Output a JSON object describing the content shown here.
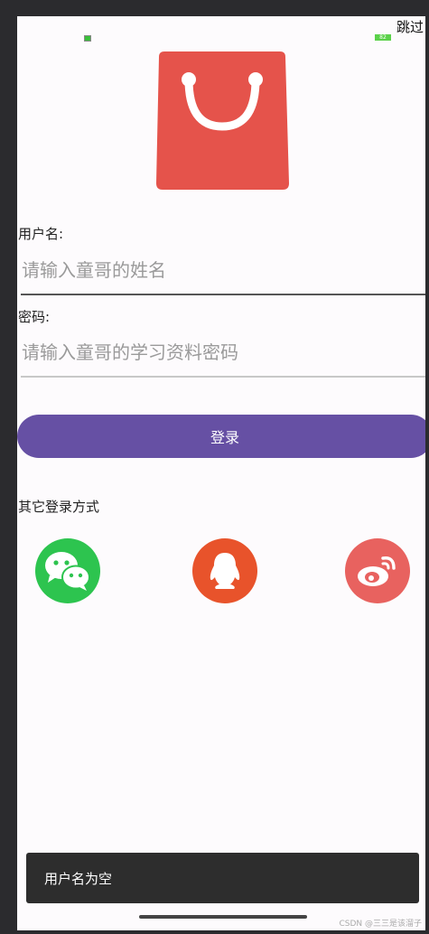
{
  "header": {
    "skip_label": "跳过"
  },
  "status": {
    "battery_text": "82"
  },
  "form": {
    "username_label": "用户名:",
    "username_placeholder": "请输入童哥的姓名",
    "password_label": "密码:",
    "password_placeholder": "请输入童哥的学习资料密码",
    "login_label": "登录"
  },
  "social": {
    "title": "其它登录方式",
    "items": [
      {
        "name": "wechat",
        "color": "#2dc44f"
      },
      {
        "name": "qq",
        "color": "#e8532b"
      },
      {
        "name": "weibo",
        "color": "#e8625f"
      }
    ]
  },
  "toast": {
    "message": "用户名为空"
  },
  "watermark": {
    "text": "CSDN @三三是该溜子"
  },
  "colors": {
    "primary": "#6650a4",
    "logo": "#e5534b"
  }
}
